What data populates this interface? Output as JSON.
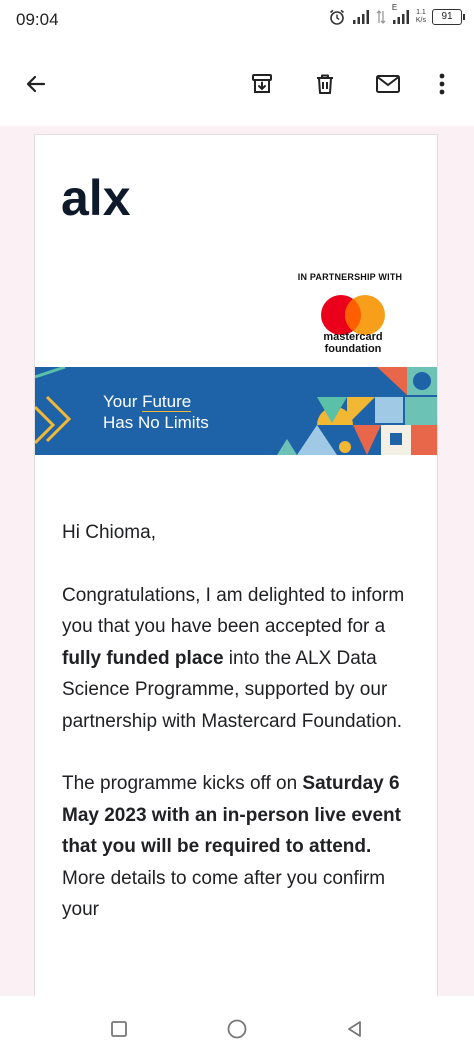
{
  "status_bar": {
    "time": "09:04",
    "signal_label_1": "E",
    "network_speed_top": "1.1",
    "network_speed_unit": "K/s",
    "battery": "91"
  },
  "toolbar": {
    "icons": [
      "back-arrow-icon",
      "archive-icon",
      "delete-icon",
      "mail-icon",
      "more-vert-icon"
    ]
  },
  "email": {
    "logo_text": "alx",
    "partner_label": "IN PARTNERSHIP WITH",
    "partner_name_line1": "mastercard",
    "partner_name_line2": "foundation",
    "banner_line1_prefix": "Your ",
    "banner_line1_emph": "Future",
    "banner_line2": "Has No Limits",
    "greeting": "Hi Chioma,",
    "p1_part1": "Congratulations, I am delighted to inform you that you have been accepted for a ",
    "p1_bold": "fully funded place",
    "p1_part2": " into the ALX Data Science Programme, supported by our partnership with Mastercard Foundation.",
    "p2_part1": "The programme kicks off on ",
    "p2_bold": "Saturday 6 May 2023 with an in-person live event that you will be required to attend.",
    "p2_part2": " More details to come after you confirm your"
  },
  "colors": {
    "banner_blue": "#1e62a8",
    "mc_red": "#eb001b",
    "mc_orange": "#f79e1b",
    "accent_yellow": "#f2b733"
  },
  "navbar": {
    "icons": [
      "recents-square-icon",
      "home-circle-icon",
      "back-triangle-icon"
    ]
  }
}
